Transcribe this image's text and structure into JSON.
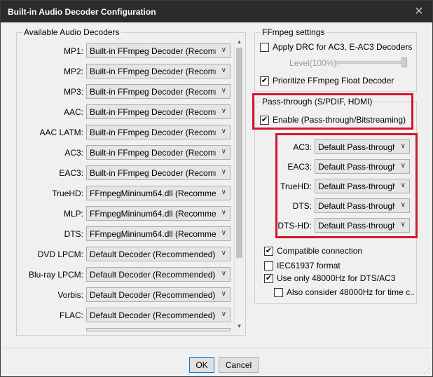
{
  "window": {
    "title": "Built-in Audio Decoder Configuration"
  },
  "icons": {
    "close": "close-icon",
    "dropdown": "chevron-down-icon",
    "check": "checkmark-icon"
  },
  "available": {
    "legend": "Available Audio Decoders",
    "rows": [
      {
        "label": "MP1:",
        "value": "Built-in FFmpeg Decoder (Recomme"
      },
      {
        "label": "MP2:",
        "value": "Built-in FFmpeg Decoder (Recomme"
      },
      {
        "label": "MP3:",
        "value": "Built-in FFmpeg Decoder (Recomme"
      },
      {
        "label": "AAC:",
        "value": "Built-in FFmpeg Decoder (Recomme"
      },
      {
        "label": "AAC LATM:",
        "value": "Built-in FFmpeg Decoder (Recomme"
      },
      {
        "label": "AC3:",
        "value": "Built-in FFmpeg Decoder (Recomme"
      },
      {
        "label": "EAC3:",
        "value": "Built-in FFmpeg Decoder (Recomme"
      },
      {
        "label": "TrueHD:",
        "value": "FFmpegMininum64.dll (Recomme"
      },
      {
        "label": "MLP:",
        "value": "FFmpegMininum64.dll (Recomme"
      },
      {
        "label": "DTS:",
        "value": "FFmpegMininum64.dll (Recomme"
      },
      {
        "label": "DVD LPCM:",
        "value": "Default Decoder (Recommended)"
      },
      {
        "label": "Blu-ray LPCM:",
        "value": "Default Decoder (Recommended)"
      },
      {
        "label": "Vorbis:",
        "value": "Default Decoder (Recommended)"
      },
      {
        "label": "FLAC:",
        "value": "Default Decoder (Recommended)"
      }
    ]
  },
  "ffmpeg": {
    "legend": "FFmpeg settings",
    "apply_drc": {
      "label": "Apply DRC for AC3, E-AC3 Decoders",
      "checked": false
    },
    "level_label": "Level(100%):",
    "prioritize_float": {
      "label": "Prioritize FFmpeg Float Decoder",
      "checked": true
    }
  },
  "passthrough": {
    "legend": "Pass-through (S/PDIF, HDMI)",
    "enable": {
      "label": "Enable (Pass-through/Bitstreaming)",
      "checked": true
    },
    "rows": [
      {
        "label": "AC3:",
        "value": "Default Pass-through"
      },
      {
        "label": "EAC3:",
        "value": "Default Pass-through"
      },
      {
        "label": "TrueHD:",
        "value": "Default Pass-through"
      },
      {
        "label": "DTS:",
        "value": "Default Pass-through"
      },
      {
        "label": "DTS-HD:",
        "value": "Default Pass-through"
      }
    ],
    "options": {
      "compatible": {
        "label": "Compatible connection",
        "checked": true
      },
      "iec61937": {
        "label": "IEC61937 format",
        "checked": false
      },
      "only48k": {
        "label": "Use only 48000Hz for DTS/AC3",
        "checked": true
      },
      "also48k": {
        "label": "Also consider 48000Hz for time c...",
        "checked": false
      }
    }
  },
  "buttons": {
    "ok": "OK",
    "cancel": "Cancel"
  },
  "colors": {
    "highlight": "#d0182c",
    "titlebar": "#2b2b2b",
    "accent": "#0078d7"
  }
}
